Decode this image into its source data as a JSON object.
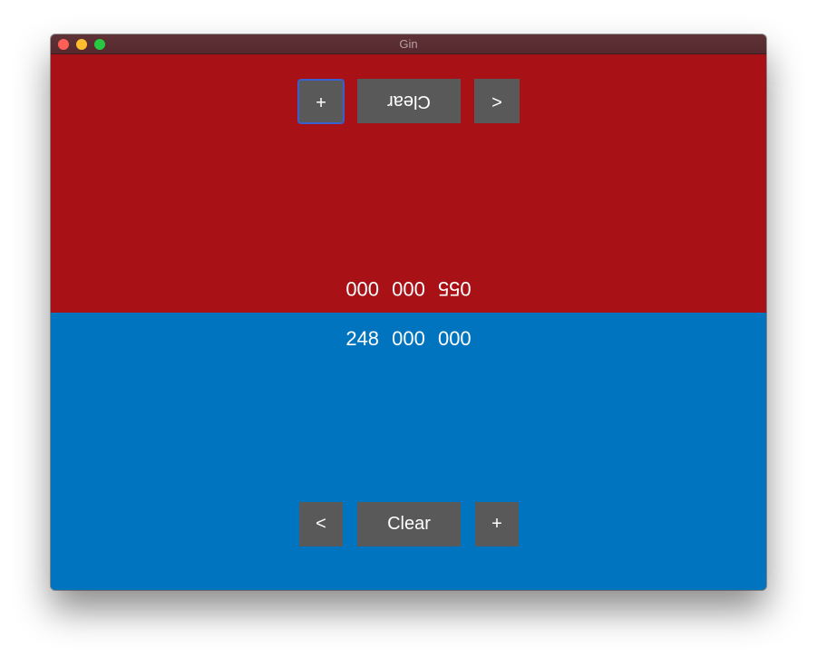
{
  "window": {
    "title": "Gin"
  },
  "colors": {
    "top_panel": "#a81216",
    "bottom_panel": "#0074bf",
    "button_bg": "#595959",
    "traffic_close": "#fe5f57",
    "traffic_minimize": "#febc2e",
    "traffic_zoom": "#28c840"
  },
  "top_player": {
    "orientation": "upside-down",
    "score": "055 000 000",
    "buttons": {
      "add_label": "+",
      "clear_label": "Clear",
      "back_label": "<"
    }
  },
  "bottom_player": {
    "orientation": "upright",
    "score": "248 000 000",
    "buttons": {
      "back_label": "<",
      "clear_label": "Clear",
      "add_label": "+"
    }
  }
}
